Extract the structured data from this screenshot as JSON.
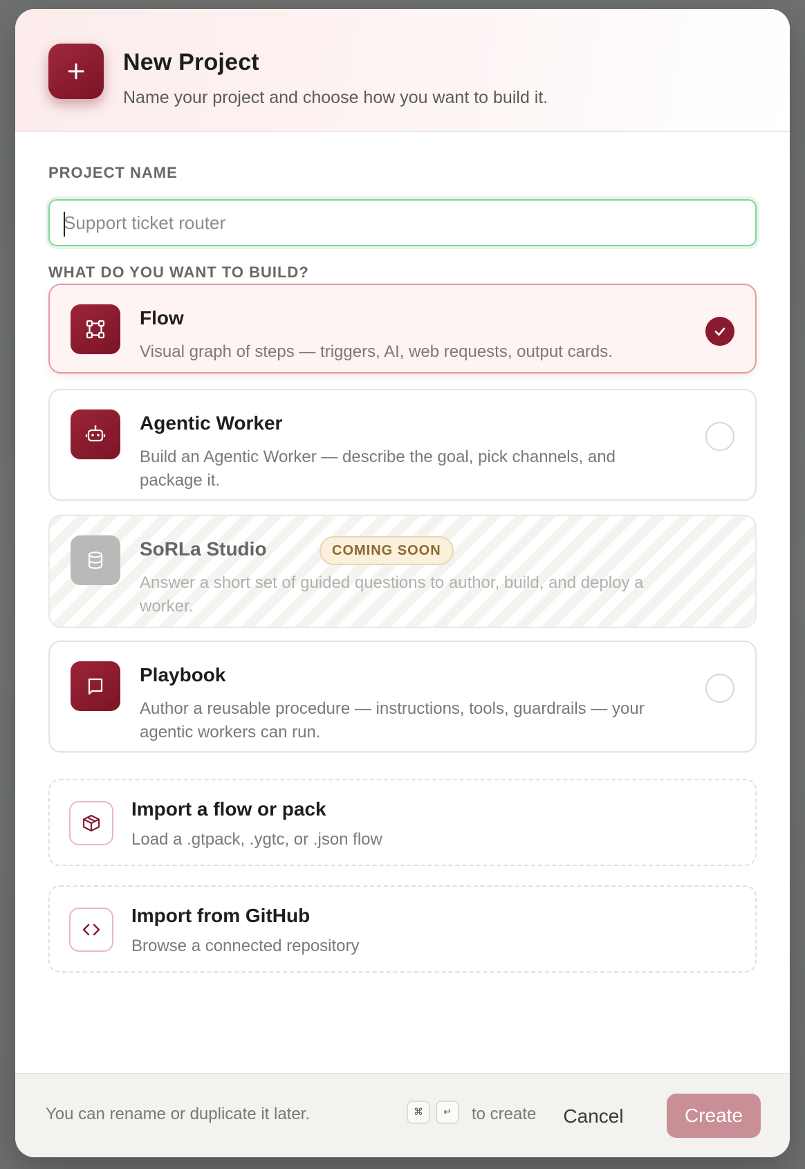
{
  "header": {
    "icon": "plus-icon",
    "title": "New Project",
    "subtitle": "Name your project and choose how you want to build it."
  },
  "project_name": {
    "label": "PROJECT NAME",
    "value": "",
    "placeholder": "Support ticket router"
  },
  "build": {
    "label": "WHAT DO YOU WANT TO BUILD?",
    "options": [
      {
        "icon": "flow-graph-icon",
        "title": "Flow",
        "description": "Visual graph of steps — triggers, AI, web requests, output cards.",
        "selected": true
      },
      {
        "icon": "robot-icon",
        "title": "Agentic Worker",
        "description": "Build an Agentic Worker — describe the goal, pick channels, and package it.",
        "selected": false
      },
      {
        "icon": "database-icon",
        "title": "SoRLa Studio",
        "badge": "COMING SOON",
        "description": "Answer a short set of guided questions to author, build, and deploy a worker.",
        "disabled": true
      },
      {
        "icon": "book-icon",
        "title": "Playbook",
        "description": "Author a reusable procedure — instructions, tools, guardrails — your agentic workers can run.",
        "selected": false
      }
    ]
  },
  "imports": [
    {
      "icon": "package-icon",
      "title": "Import a flow or pack",
      "description": "Load a .gtpack, .ygtc, or .json flow"
    },
    {
      "icon": "code-icon",
      "title": "Import from GitHub",
      "description": "Browse a connected repository"
    }
  ],
  "footer": {
    "hint": "You can rename or duplicate it later.",
    "kbd_cmd": "⌘",
    "kbd_enter": "↵",
    "create_hint": "to create",
    "cancel_label": "Cancel",
    "create_label": "Create"
  },
  "colors": {
    "accent": "#8a1a2d",
    "accent_light": "#fdf4f3",
    "input_focus": "#86d39a",
    "create_disabled": "#c98f96"
  }
}
